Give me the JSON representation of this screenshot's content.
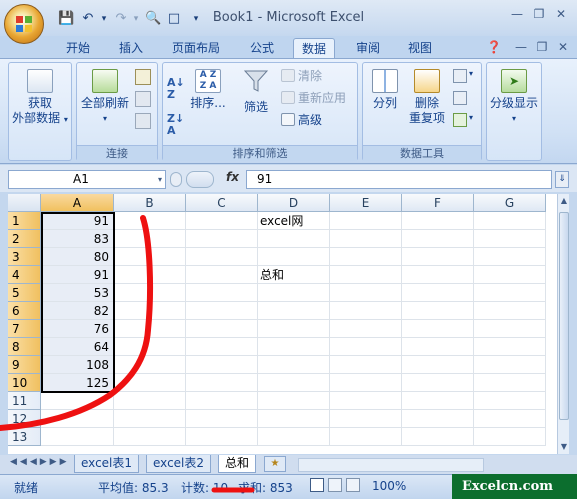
{
  "window": {
    "title": "Book1 - Microsoft Excel"
  },
  "qat": {
    "save_icon": "save-icon",
    "undo_icon": "undo-icon",
    "redo_icon": "redo-icon"
  },
  "tabs": [
    "开始",
    "插入",
    "页面布局",
    "公式",
    "数据",
    "审阅",
    "视图"
  ],
  "active_tab": "数据",
  "ribbon": {
    "get_external": {
      "label_1": "获取",
      "label_2": "外部数据"
    },
    "connections": {
      "refresh_label": "全部刷新",
      "group_label": "连接"
    },
    "sort_filter": {
      "sort_label": "排序...",
      "filter_label": "筛选",
      "clear_label": "清除",
      "reapply_label": "重新应用",
      "advanced_label": "高级",
      "group_label": "排序和筛选"
    },
    "data_tools": {
      "split_label": "分列",
      "remove_dup_1": "删除",
      "remove_dup_2": "重复项",
      "group_label": "数据工具"
    },
    "outline": {
      "label": "分级显示"
    }
  },
  "formula_bar": {
    "name_box": "A1",
    "fx": "fx",
    "value": "91"
  },
  "columns": [
    "A",
    "B",
    "C",
    "D",
    "E",
    "F",
    "G"
  ],
  "rows": [
    "1",
    "2",
    "3",
    "4",
    "5",
    "6",
    "7",
    "8",
    "9",
    "10",
    "11",
    "12",
    "13"
  ],
  "cells": {
    "A": [
      "91",
      "83",
      "80",
      "91",
      "53",
      "82",
      "76",
      "64",
      "108",
      "125"
    ],
    "D1": "excel网",
    "D4": "总和"
  },
  "sheet_tabs": [
    "excel表1",
    "excel表2",
    "总和"
  ],
  "active_sheet": "总和",
  "status": {
    "ready": "就绪",
    "average": "平均值: 85.3",
    "count": "计数: 10",
    "sum": "求和: 853",
    "zoom": "100%"
  },
  "watermark": "Excelcn.com"
}
